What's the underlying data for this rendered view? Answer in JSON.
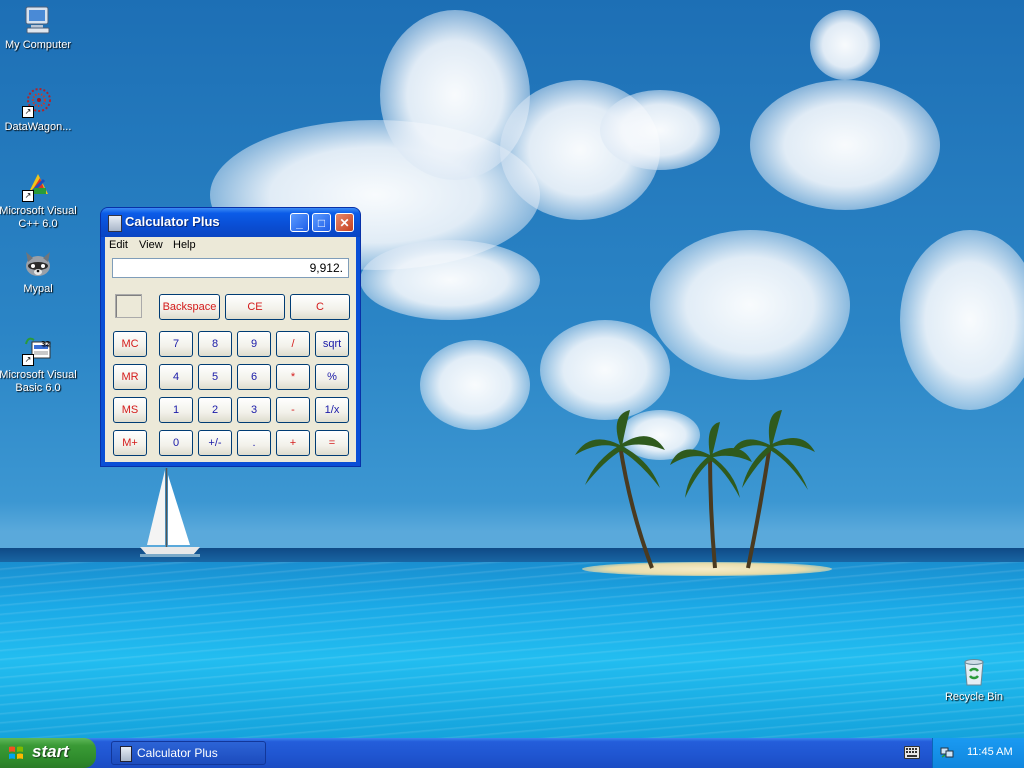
{
  "desktop": {
    "icons": [
      {
        "label": "My Computer"
      },
      {
        "label": "DataWagon..."
      },
      {
        "label": "Microsoft Visual C++ 6.0"
      },
      {
        "label": "Mypal"
      },
      {
        "label": "Microsoft Visual Basic 6.0"
      },
      {
        "label": "Recycle Bin"
      }
    ]
  },
  "window": {
    "title": "Calculator Plus",
    "menu": [
      "Edit",
      "View",
      "Help"
    ],
    "display_value": "9,912.",
    "controls": {
      "minimize": "_",
      "maximize": "□",
      "close": "✕"
    }
  },
  "calculator": {
    "top_row": [
      "Backspace",
      "CE",
      "C"
    ],
    "rows": [
      [
        "MC",
        "7",
        "8",
        "9",
        "/",
        "sqrt"
      ],
      [
        "MR",
        "4",
        "5",
        "6",
        "*",
        "%"
      ],
      [
        "MS",
        "1",
        "2",
        "3",
        "-",
        "1/x"
      ],
      [
        "M+",
        "0",
        "+/-",
        ".",
        "+",
        "="
      ]
    ]
  },
  "taskbar": {
    "start_label": "start",
    "task_label": "Calculator Plus",
    "clock": "11:45 AM"
  },
  "colors": {
    "accent_red": "#d41b1b",
    "accent_blue": "#1a1aa8",
    "titlebar": "#0a4ed4",
    "start_green": "#3a9a36"
  }
}
